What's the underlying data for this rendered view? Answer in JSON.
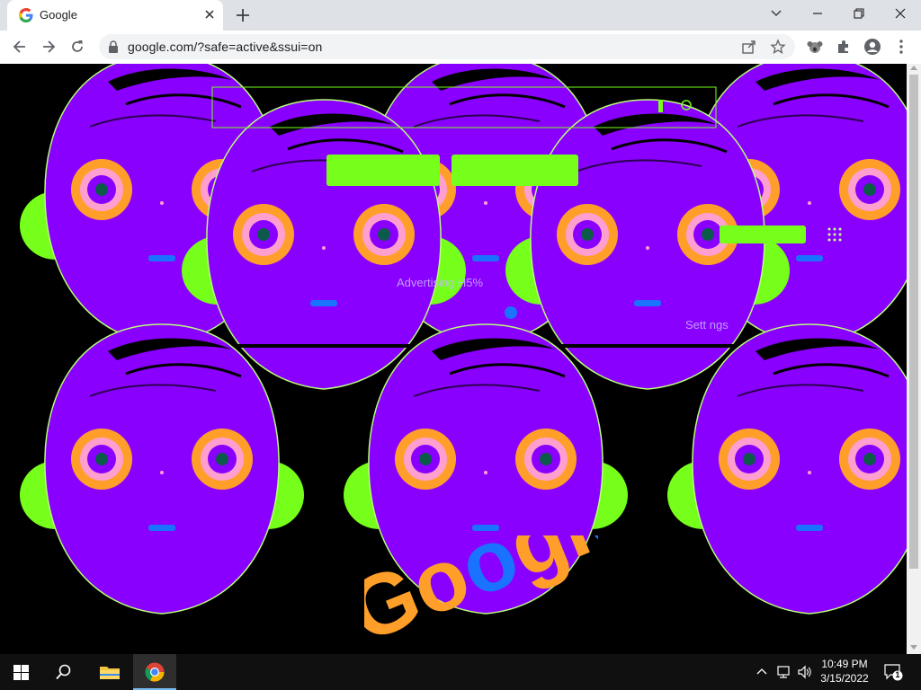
{
  "browser": {
    "tab_title": "Google",
    "url": "google.com/?safe=active&ssui=on",
    "favicon": "google-g-icon"
  },
  "page": {
    "background": "#000000",
    "overlay_labels": {
      "advertising": "Advertising  H5%",
      "settings": "Sett ngs"
    },
    "logo_text": "Google",
    "colors": {
      "purple": "#8a00ff",
      "green": "#75ff1a",
      "orange": "#ff9f2a",
      "blue": "#1a73ff",
      "teal": "#0b5a4a"
    }
  },
  "taskbar": {
    "time": "10:49 PM",
    "date": "3/15/2022",
    "notification_count": "1",
    "apps": [
      "start-icon",
      "search-icon",
      "file-explorer-icon",
      "chrome-icon"
    ]
  }
}
